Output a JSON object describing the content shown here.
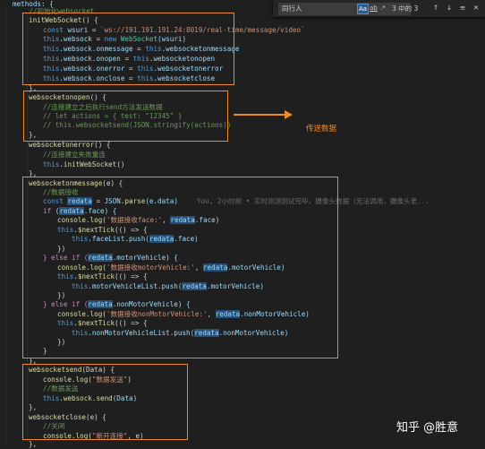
{
  "find_widget": {
    "query": "同行人",
    "opt_case": "Aa",
    "opt_word": "ab",
    "opt_regex": ".*",
    "count": "3 中的 3",
    "prev": "↑",
    "next": "↓",
    "selection": "≡",
    "close": "✕"
  },
  "code": {
    "l0": "methods: {",
    "l1": "    //初始化websocket",
    "l2_fn": "initWebSocket",
    "l2_rest": "() {",
    "l3_kw": "const",
    "l3_var": "wsuri",
    "l3_eq": " = ",
    "l3_str": "`ws://191.191.191.24:8019/real-time/message/video`",
    "l4_this": "this",
    "l4_prop": ".websock",
    "l4_eq": " = ",
    "l4_new": "new",
    "l4_cls": "WebSocket",
    "l4_arg": "(wsuri)",
    "l5_a": ".websock.onmessage",
    "l5_b": ".websocketonmessage",
    "l6_a": ".websock.onopen",
    "l6_b": ".websocketonopen",
    "l7_a": ".websock.onerror",
    "l7_b": ".websocketonerror",
    "l8_a": ".websock.onclose",
    "l8_b": ".websocketclose",
    "l9": "},",
    "l10_fn": "websocketonopen",
    "l10_rest": "() {",
    "l11": "//连接建立之后执行send方法发送数据",
    "l12": "// let actions = { test: \"12345\" }",
    "l13": "// this.websocketsend(JSON.stringify(actions))",
    "l14": "},",
    "l15_fn": "websocketonerror",
    "l15_rest": "() {",
    "l16": "//连接建立失败重连",
    "l17_fn": ".initWebSocket",
    "l17_rest": "()",
    "l18": "},",
    "l19_fn": "websocketonmessage",
    "l19_rest": "(e) {",
    "l20": "//数据接收",
    "l21_kw": "const",
    "l21_var": "redata",
    "l21_json": "JSON",
    "l21_fn": ".parse",
    "l21_rest": "(e.data)",
    "l21_ghost": "You, 2小时前 • 实时测测测试完毕，摄像头数据（无法调用，摄像头老...",
    "l22_if": "if",
    "l22_rest": ".face) {",
    "l23_fn": "console.log",
    "l23_str": "'数据接收face:'",
    "l23_rest": ".face)",
    "l24_fn": ".$nextTick",
    "l24_rest": "(() => {",
    "l25_a": ".faceList.push(",
    "l25_b": ".face)",
    "l26": "})",
    "l27_else": "} else if (",
    "l27_rest": ".motorVehicle) {",
    "l28_str": "'数据接收motorVehicle:'",
    "l28_rest": ".motorVehicle)",
    "l29_rest": "(() => {",
    "l30_a": ".motorVehicleList.push(",
    "l30_b": ".motorVehicle)",
    "l31": "})",
    "l32_rest": ".nonMotorVehicle) {",
    "l33_str": "'数据接收nonMotorVehicle:'",
    "l33_rest": ".nonMotorVehicle)",
    "l35_a": ".nonMotorVehicleList.push(",
    "l35_b": ".nonMotorVehicle)",
    "l36": "})",
    "l37": "}",
    "l38": "},",
    "l39_fn": "websocketsend",
    "l39_rest": "(Data) {",
    "l40_str": "\"数据发送\"",
    "l41": "//数据发送",
    "l42_fn": ".websock.send",
    "l42_rest": "(Data)",
    "l43": "},",
    "l44_fn": "websocketclose",
    "l44_rest": "(e) {",
    "l45": "//关闭",
    "l46_str": "\"断开连接\"",
    "l46_rest": ", e)",
    "l47": "},",
    "this": "this",
    "redata": "redata",
    "console": "console.log(",
    "nexttick": ".$nextTick"
  },
  "annotation": {
    "callout": "传送数据",
    "color": "#f08a24"
  },
  "watermark": "知乎 @胜意"
}
